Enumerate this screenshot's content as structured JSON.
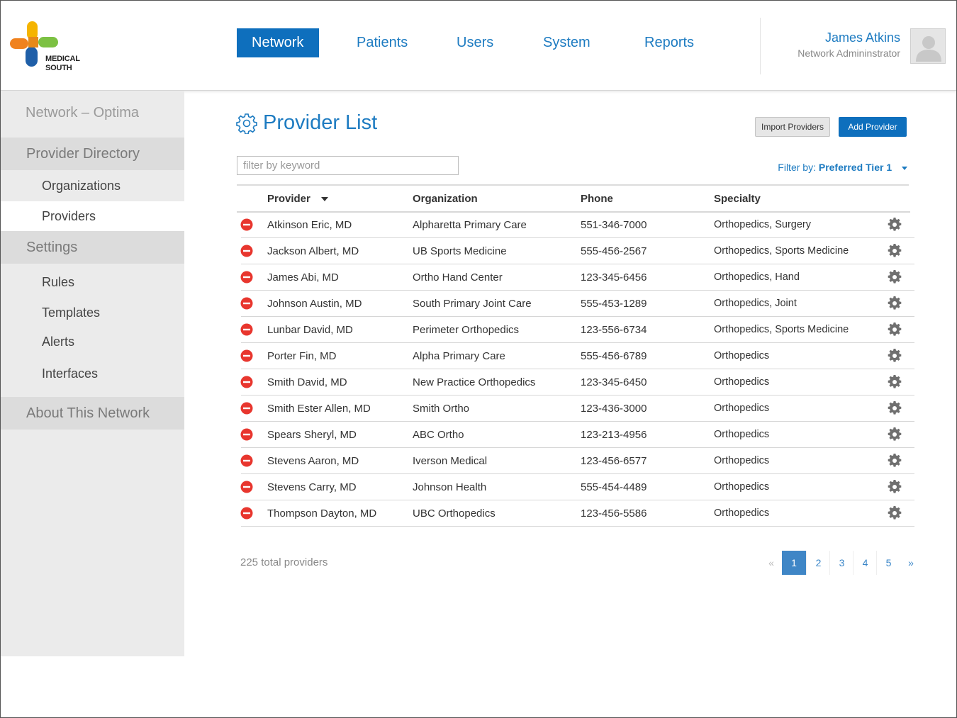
{
  "brand": {
    "line1": "MEDICAL",
    "line2": "SOUTH"
  },
  "nav": [
    {
      "label": "Network",
      "active": true
    },
    {
      "label": "Patients",
      "active": false
    },
    {
      "label": "Users",
      "active": false
    },
    {
      "label": "System",
      "active": false
    },
    {
      "label": "Reports",
      "active": false
    }
  ],
  "user": {
    "name": "James Atkins",
    "role": "Network Admininstrator"
  },
  "sidebar": {
    "network": "Network – Optima",
    "provider_directory": "Provider Directory",
    "organizations": "Organizations",
    "providers": "Providers",
    "settings": "Settings",
    "rules": "Rules",
    "templates": "Templates",
    "alerts": "Alerts",
    "interfaces": "Interfaces",
    "about": "About This Network"
  },
  "page": {
    "title": "Provider List",
    "import_label": "Import Providers",
    "add_label": "Add Provider",
    "search_placeholder": "filter by keyword",
    "filter_label": "Filter by:",
    "filter_value": "Preferred Tier 1"
  },
  "columns": {
    "provider": "Provider",
    "organization": "Organization",
    "phone": "Phone",
    "specialty": "Specialty"
  },
  "rows": [
    {
      "provider": "Atkinson Eric, MD",
      "organization": "Alpharetta Primary Care",
      "phone": "551-346-7000",
      "specialty": "Orthopedics, Surgery"
    },
    {
      "provider": "Jackson Albert, MD",
      "organization": "UB Sports Medicine",
      "phone": "555-456-2567",
      "specialty": "Orthopedics, Sports Medicine"
    },
    {
      "provider": "James Abi, MD",
      "organization": "Ortho Hand Center",
      "phone": "123-345-6456",
      "specialty": "Orthopedics, Hand"
    },
    {
      "provider": "Johnson Austin, MD",
      "organization": "South Primary Joint Care",
      "phone": "555-453-1289",
      "specialty": "Orthopedics, Joint"
    },
    {
      "provider": "Lunbar David, MD",
      "organization": "Perimeter Orthopedics",
      "phone": "123-556-6734",
      "specialty": "Orthopedics, Sports Medicine"
    },
    {
      "provider": "Porter Fin, MD",
      "organization": "Alpha Primary Care",
      "phone": "555-456-6789",
      "specialty": "Orthopedics"
    },
    {
      "provider": "Smith David, MD",
      "organization": "New Practice Orthopedics",
      "phone": "123-345-6450",
      "specialty": "Orthopedics"
    },
    {
      "provider": "Smith Ester Allen, MD",
      "organization": "Smith Ortho",
      "phone": "123-436-3000",
      "specialty": "Orthopedics"
    },
    {
      "provider": "Spears Sheryl, MD",
      "organization": "ABC Ortho",
      "phone": "123-213-4956",
      "specialty": "Orthopedics"
    },
    {
      "provider": "Stevens Aaron, MD",
      "organization": "Iverson Medical",
      "phone": "123-456-6577",
      "specialty": "Orthopedics"
    },
    {
      "provider": "Stevens Carry, MD",
      "organization": "Johnson Health",
      "phone": "555-454-4489",
      "specialty": "Orthopedics"
    },
    {
      "provider": "Thompson Dayton, MD",
      "organization": "UBC Orthopedics",
      "phone": "123-456-5586",
      "specialty": "Orthopedics"
    }
  ],
  "total": "225 total providers",
  "pagination": {
    "prev": "«",
    "pages": [
      "1",
      "2",
      "3",
      "4",
      "5"
    ],
    "current": "1",
    "next": "»"
  },
  "colors": {
    "accent": "#0e6fbd",
    "link": "#1d7bc1",
    "remove": "#e8362e",
    "sidebar": "#ebebeb"
  },
  "icons": {
    "remove": "minus-circle-icon",
    "row_action": "gear-icon",
    "title": "gear-outline-icon",
    "avatar": "user-silhouette-icon"
  }
}
